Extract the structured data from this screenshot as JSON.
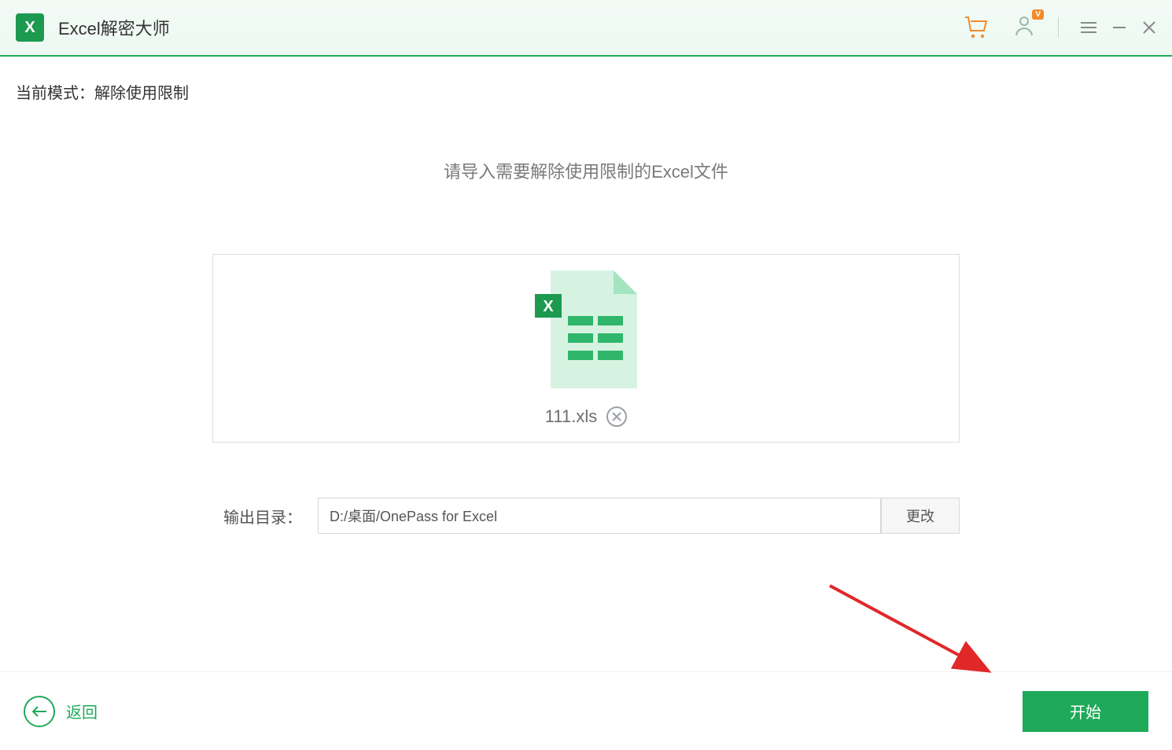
{
  "titlebar": {
    "app_name": "Excel解密大师",
    "user_badge": "V"
  },
  "main": {
    "mode_prefix": "当前模式：",
    "mode_value": "解除使用限制",
    "instruction": "请导入需要解除使用限制的Excel文件",
    "file": {
      "name": "111.xls"
    },
    "output": {
      "label": "输出目录：",
      "path": "D:/桌面/OnePass for Excel",
      "change_label": "更改"
    }
  },
  "footer": {
    "back_label": "返回",
    "start_label": "开始"
  }
}
